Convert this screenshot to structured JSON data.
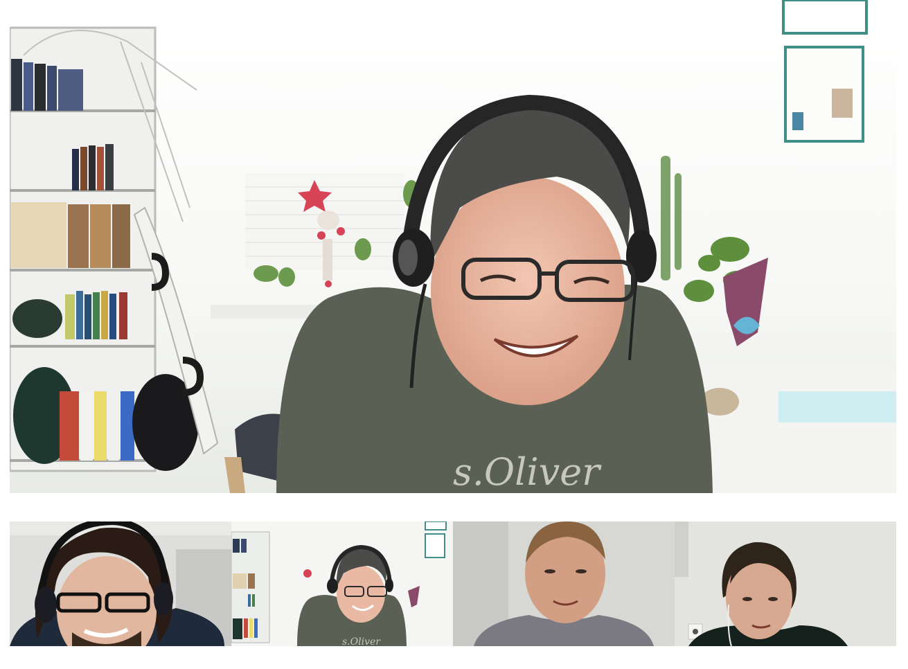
{
  "app": {
    "title": ""
  },
  "main_video": {
    "participant_ref": "participant-2",
    "shirt_text": "s.Oliver"
  },
  "participants": [
    {
      "id": "participant-1",
      "tile": "thumb-1"
    },
    {
      "id": "participant-2",
      "tile": "thumb-2",
      "shirt_text": "s.Oliver"
    },
    {
      "id": "participant-3",
      "tile": "thumb-3"
    },
    {
      "id": "participant-4",
      "tile": "thumb-4"
    }
  ],
  "colors": {
    "background": "#ffffff",
    "shirt_main": "#5a5f52",
    "hair_main": "#4a4a48",
    "skin": "#e9b9a3",
    "headset": "#2a2a2a"
  }
}
